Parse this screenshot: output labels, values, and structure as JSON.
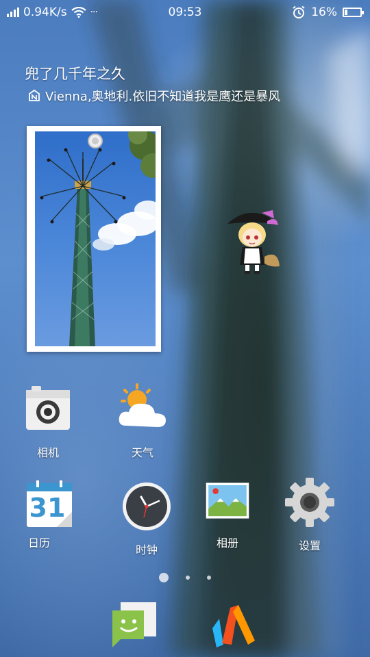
{
  "status_bar": {
    "network_speed": "0.94K/s",
    "overflow": "···",
    "time": "09:53",
    "battery_percent": "16%",
    "battery_level": 0.16,
    "icons": [
      "signal-icon",
      "wifi-icon",
      "alarm-icon",
      "battery-icon"
    ]
  },
  "widget": {
    "title": "兜了几千年之久",
    "subtitle": "Vienna,奥地利.依旧不知道我是鹰还是暴风"
  },
  "apps": {
    "camera": "相机",
    "weather": "天气",
    "calendar": "日历",
    "calendar_day": "31",
    "clock": "时钟",
    "gallery": "相册",
    "settings": "设置"
  },
  "pages": {
    "count": 3,
    "current": 1
  },
  "dock": {
    "icons": [
      "messages-icon",
      "browser-icon"
    ]
  },
  "colors": {
    "sky": "#4b7cbe",
    "messages_green": "#8bc34a",
    "settings_gray": "#cfcfcf",
    "clock_face": "#3a3f45"
  }
}
